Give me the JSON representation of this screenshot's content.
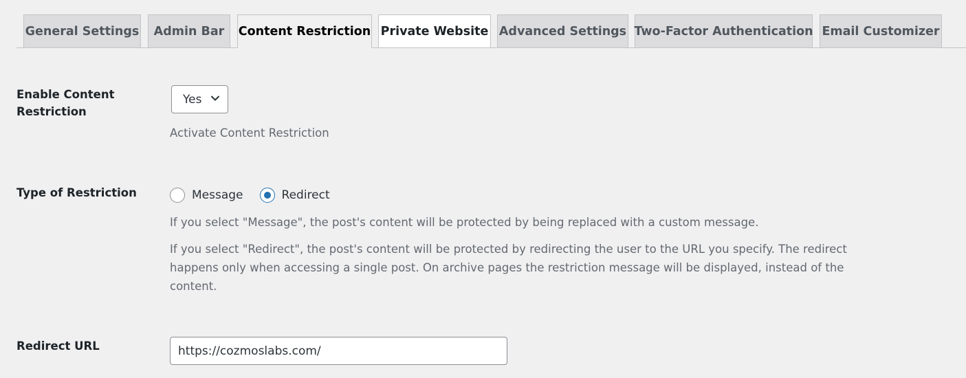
{
  "tabs": [
    {
      "label": "General Settings"
    },
    {
      "label": "Admin Bar"
    },
    {
      "label": "Content Restriction"
    },
    {
      "label": "Private Website"
    },
    {
      "label": "Advanced Settings"
    },
    {
      "label": "Two-Factor Authentication"
    },
    {
      "label": "Email Customizer"
    }
  ],
  "active_tab": "Content Restriction",
  "enable_content_restriction": {
    "label_line1": "Enable Content",
    "label_line2": "Restriction",
    "selected": "Yes",
    "description": "Activate Content Restriction"
  },
  "type_of_restriction": {
    "label": "Type of Restriction",
    "options": [
      {
        "label": "Message",
        "checked": false
      },
      {
        "label": "Redirect",
        "checked": true
      }
    ],
    "description_message": "If you select \"Message\", the post's content will be protected by being replaced with a custom message.",
    "description_redirect_line1": "If you select \"Redirect\", the post's content will be protected by redirecting the user to the URL you specify. The redirect",
    "description_redirect_line2": "happens only when accessing a single post. On archive pages the restriction message will be displayed, instead of the",
    "description_redirect_line3": "content."
  },
  "redirect_url": {
    "label": "Redirect URL",
    "value": "https://cozmoslabs.com/"
  },
  "icons": {
    "select_arrow": "chevron-down-icon"
  }
}
